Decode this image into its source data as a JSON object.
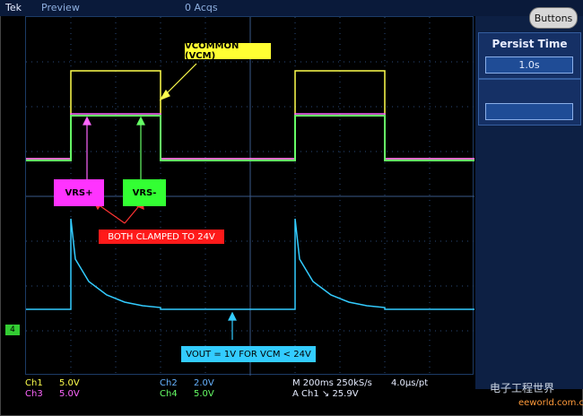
{
  "top_bar": {
    "brand": "Tek",
    "mode": "Preview",
    "acqs": "0 Acqs"
  },
  "side_panel": {
    "buttons_label": "Buttons",
    "persist_time_title": "Persist Time",
    "persist_time_value": "1.0s"
  },
  "labels": {
    "vcm": "VCOMMON (VCM)",
    "vrsp": "VRS+",
    "vrsm": "VRS-",
    "clamped": "BOTH CLAMPED TO 24V",
    "vout": "VOUT = 1V FOR VCM < 24V"
  },
  "ground_marker": "4",
  "readouts": {
    "ch1": "Ch1",
    "ch1_scale": "5.0V",
    "ch3": "Ch3",
    "ch3_scale": "5.0V",
    "ch2": "Ch2",
    "ch2_scale": "2.0V",
    "ch4": "Ch4",
    "ch4_scale": "5.0V",
    "time": "M 200ms 250kS/s",
    "rate": "4.0μs/pt",
    "trigger": "A  Ch1  ↘  25.9V"
  },
  "watermark": {
    "text1": "电子工程世界",
    "text2": "eeworld.com.cn"
  },
  "colors": {
    "ch1": "#ffff4d",
    "ch2": "#66b3ff",
    "ch3": "#ff66ff",
    "ch4": "#66ff66"
  }
}
